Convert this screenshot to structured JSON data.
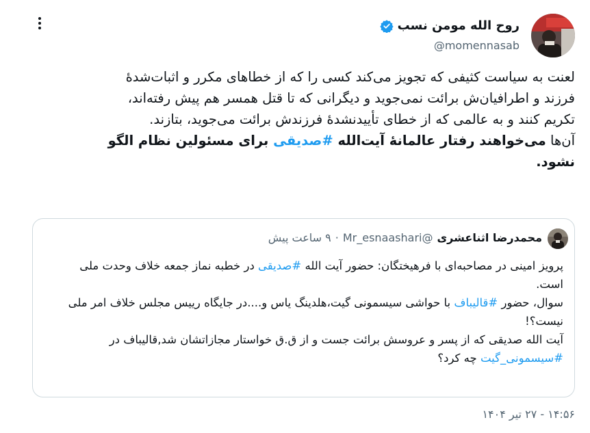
{
  "author": {
    "display_name": "روح الله مومن نسب",
    "handle": "@momennasab",
    "verified_color": "#1d9bf0"
  },
  "more_icon": "ellipsis-vertical-icon",
  "tweet": {
    "line1": "لعنت به سیاست کثیفی که تجویز می‌کند کسی را که از خطاهای مکرر و اثبات‌شدهٔ",
    "line2": "فرزند و اطرافیان‌ش برائت نمی‌جوید و دیگرانی که تا قتل همسر هم پیش رفته‌اند،",
    "line3": "تکریم کنند و به عالمی که از خطای تأییدنشدهٔ فرزندش برائت می‌جوید، بتازند.",
    "line4_start": "آن‌ها ",
    "line4_bold1": "می‌خواهند رفتار عالمانهٔ آیت‌الله ",
    "line4_hashtag": "#صدیقی",
    "line4_bold2": " برای مسئولین نظام الگو",
    "line5_bold": "نشود."
  },
  "quote": {
    "display_name": "محمدرضا اثناعشری",
    "handle": "@Mr_esnaashari",
    "dot": "·",
    "time": "۹ ساعت پیش",
    "p1_a": "پرویز امینی در مصاحبه‌ای با فرهیختگان: حضور آیت الله ",
    "p1_hashtag": "#صدیقی",
    "p1_b": " در خطبه نماز جمعه خلاف وحدت ملی است.",
    "p2_a": "سوال، حضور ",
    "p2_hashtag": "#قالیباف",
    "p2_b": " با حواشی سیسمونی گیت،هلدینگ یاس و....در جایگاه رییس مجلس خلاف امر ملی نیست؟!",
    "p3_a": "آیت الله صدیقی که از پسر و عروسش برائت جست و از ق.ق خواستار مجازاتشان شد,قالیباف در ",
    "p3_hashtag": "#سیسمونی_گیت",
    "p3_b": " چه کرد؟"
  },
  "timestamp": "۱۴:۵۶ - ۲۷ تیر ۱۴۰۴",
  "colors": {
    "text": "#0f1419",
    "secondary": "#536471",
    "accent": "#1d9bf0",
    "border": "#cfd9de"
  }
}
